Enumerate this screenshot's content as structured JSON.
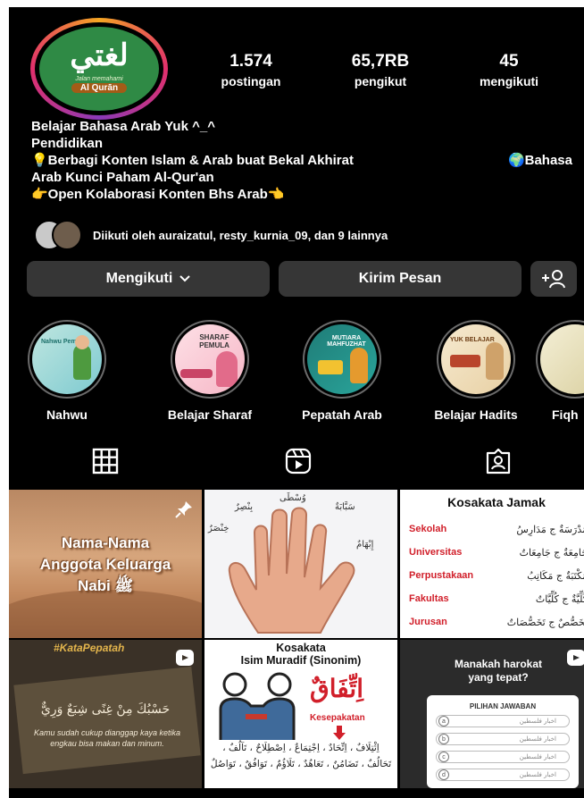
{
  "profile": {
    "avatar_text": "لغتي",
    "avatar_tagline": "Jalan memahami",
    "avatar_banner": "Al Qurān"
  },
  "stats": [
    {
      "value": "1.574",
      "label": "postingan"
    },
    {
      "value": "65,7RB",
      "label": "pengikut"
    },
    {
      "value": "45",
      "label": "mengikuti"
    }
  ],
  "bio": {
    "name": "Belajar Bahasa Arab Yuk ^_^",
    "category": "Pendidikan",
    "line1_left": "💡Berbagi Konten Islam & Arab buat Bekal Akhirat",
    "line1_right": "🌍Bahasa",
    "line2": "Arab Kunci Paham Al-Qur'an",
    "line3": "👉Open Kolaborasi Konten Bhs Arab👈"
  },
  "followed_by": "Diikuti oleh auraizatul, resty_kurnia_09, dan 9 lainnya",
  "buttons": {
    "following": "Mengikuti",
    "message": "Kirim Pesan"
  },
  "highlights": [
    {
      "label": "Nahwu",
      "tag": "Nahwu Pemula"
    },
    {
      "label": "Belajar Sharaf",
      "tag": "SHARAF PEMULA"
    },
    {
      "label": "Pepatah Arab",
      "tag": "MUTIARA MAHFUZHAT"
    },
    {
      "label": "Belajar Hadits",
      "tag": "YUK BELAJAR"
    },
    {
      "label": "Fiqh",
      "tag": ""
    }
  ],
  "tabs": [
    "grid-icon",
    "reels-icon",
    "tagged-icon"
  ],
  "posts": {
    "p1": {
      "title_1": "Nama-Nama",
      "title_2": "Anggota Keluarga",
      "title_3": "Nabi ﷺ"
    },
    "p2": {
      "labels": [
        "بِنْصِرٌ",
        "وُسْطَى",
        "سَبَّابَةٌ",
        "خِنْصَرٌ",
        "إِبْهَامٌ"
      ]
    },
    "p3": {
      "title": "Kosakata Jamak",
      "rows": [
        {
          "id": "Sekolah",
          "ar": "مَدْرَسَةٌ ج مَدَارِسُ"
        },
        {
          "id": "Universitas",
          "ar": "جَامِعَةٌ ج جَامِعَاتٌ"
        },
        {
          "id": "Perpustakaan",
          "ar": "مَكْتَبَةٌ ج مَكَاتِبُ"
        },
        {
          "id": "Fakultas",
          "ar": "كُلِّيَّةٌ ج كُلِّيَّاتٌ"
        },
        {
          "id": "Jurusan",
          "ar": "تَخَصُّصٌ ج تَخَصُّصَاتٌ"
        }
      ]
    },
    "p4": {
      "tag": "#KataPepatah",
      "arabic": "حَسْبُكَ مِنْ غِنًى شِبَعٌ وَرِيٌّ",
      "text": "Kamu sudah cukup dianggap kaya ketika engkau bisa makan dan minum."
    },
    "p5": {
      "title_1": "Kosakata",
      "title_2": "Isim Muradif (Sinonim)",
      "arabic": "اِتِّفَاقٌ",
      "meaning": "Kesepakatan",
      "list": "اِئْتِلَافٌ ، اِتِّحَادٌ ، اِجْتِمَاعٌ ، اِصْطِلَاحٌ ، تَآلُفٌ ، تَحَالُفٌ ، تَضَامُنٌ ، تَعَاهُدٌ ، تَلَاؤُمٌ ، تَوَافُقٌ ، تَوَاصُلٌ"
    },
    "p6": {
      "title_1": "Manakah harokat",
      "title_2": "yang tepat?",
      "header": "PILIHAN JAWABAN",
      "options": [
        "a",
        "b",
        "c",
        "d"
      ],
      "option_text": "اخبار فلسطين"
    }
  },
  "colors": {
    "background": "#000000",
    "button": "#363636",
    "accent_red": "#d11f2a",
    "avatar_green": "#2f8a45"
  }
}
